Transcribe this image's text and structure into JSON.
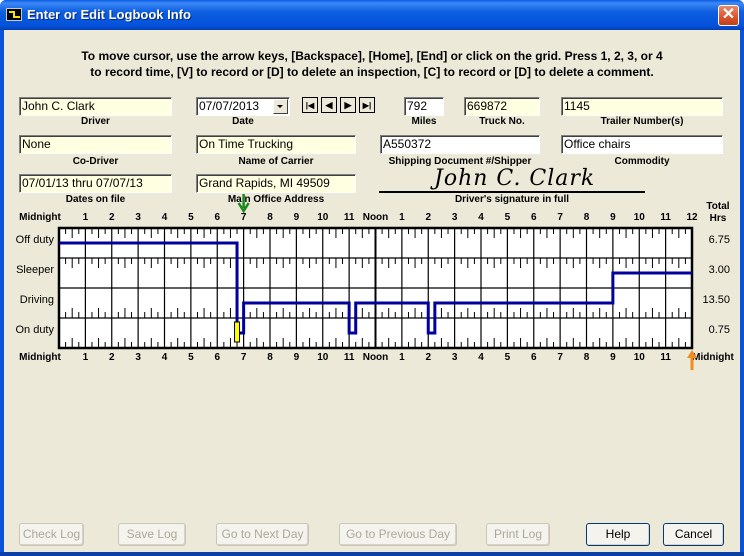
{
  "window": {
    "title": "Enter or Edit Logbook Info",
    "close_icon": "close-icon"
  },
  "instructions": {
    "line1": "To move cursor, use the arrow keys, [Backspace], [Home], [End] or click on the grid.  Press 1, 2, 3, or 4",
    "line2": "to record time, [V] to record or [D] to delete an inspection, [C] to record or [D] to delete a comment."
  },
  "fields": {
    "driver": {
      "label": "Driver",
      "value": "John C. Clark"
    },
    "date": {
      "label": "Date",
      "value": "07/07/2013"
    },
    "miles": {
      "label": "Miles",
      "value": "792"
    },
    "truck_no": {
      "label": "Truck No.",
      "value": "669872"
    },
    "trailer": {
      "label": "Trailer Number(s)",
      "value": "1145"
    },
    "co_driver": {
      "label": "Co-Driver",
      "value": "None"
    },
    "carrier": {
      "label": "Name of Carrier",
      "value": "On Time Trucking"
    },
    "shipping_doc": {
      "label": "Shipping Document #/Shipper",
      "value": "A550372"
    },
    "commodity": {
      "label": "Commodity",
      "value": "Office chairs"
    },
    "dates_on_file": {
      "label": "Dates on file",
      "value": "07/01/13 thru 07/07/13"
    },
    "main_office": {
      "label": "Main Office Address",
      "value": "Grand Rapids, MI  49509"
    }
  },
  "nav_buttons": [
    {
      "name": "first-day",
      "glyph": "|◀"
    },
    {
      "name": "previous-day",
      "glyph": "◀"
    },
    {
      "name": "next-day",
      "glyph": "▶"
    },
    {
      "name": "last-day",
      "glyph": "▶|"
    }
  ],
  "signature": {
    "value": "John C. Clark",
    "label": "Driver's signature in full"
  },
  "grid": {
    "hour_labels": [
      "Midnight",
      "1",
      "2",
      "3",
      "4",
      "5",
      "6",
      "7",
      "8",
      "9",
      "10",
      "11",
      "Noon",
      "1",
      "2",
      "3",
      "4",
      "5",
      "6",
      "7",
      "8",
      "9",
      "10",
      "11",
      "12"
    ],
    "bottom_hour_labels": [
      "Midnight",
      "1",
      "2",
      "3",
      "4",
      "5",
      "6",
      "7",
      "8",
      "9",
      "10",
      "11",
      "Noon",
      "1",
      "2",
      "3",
      "4",
      "5",
      "6",
      "7",
      "8",
      "9",
      "10",
      "11",
      "Midnight"
    ],
    "total_header_1": "Total",
    "total_header_2": "Hrs",
    "rows": [
      {
        "label": "Off duty",
        "total": "6.75"
      },
      {
        "label": "Sleeper",
        "total": "3.00"
      },
      {
        "label": "Driving",
        "total": "13.50"
      },
      {
        "label": "On duty",
        "total": "0.75"
      }
    ],
    "segments": [
      {
        "status": 0,
        "start": 0,
        "end": 6.75
      },
      {
        "status": 3,
        "start": 6.75,
        "end": 7.0
      },
      {
        "status": 2,
        "start": 7.0,
        "end": 11.0
      },
      {
        "status": 3,
        "start": 11.0,
        "end": 11.25
      },
      {
        "status": 2,
        "start": 11.25,
        "end": 14.0
      },
      {
        "status": 3,
        "start": 14.0,
        "end": 14.25
      },
      {
        "status": 2,
        "start": 14.25,
        "end": 21.0
      },
      {
        "status": 1,
        "start": 21.0,
        "end": 24.0
      }
    ],
    "inspection_marker_hour": 6.75,
    "start_arrow_hour": 7.0,
    "cursor_arrow_hour": 24.0,
    "colors": {
      "line": "#00009c",
      "inspection": "#ffff00",
      "start_arrow": "#1a8a1a",
      "cursor_arrow": "#f08c1e"
    }
  },
  "buttons": {
    "check_log": "Check Log",
    "save_log": "Save Log",
    "next_day": "Go to Next Day",
    "previous_day": "Go to Previous Day",
    "print_log": "Print Log",
    "help": "Help",
    "cancel": "Cancel"
  }
}
